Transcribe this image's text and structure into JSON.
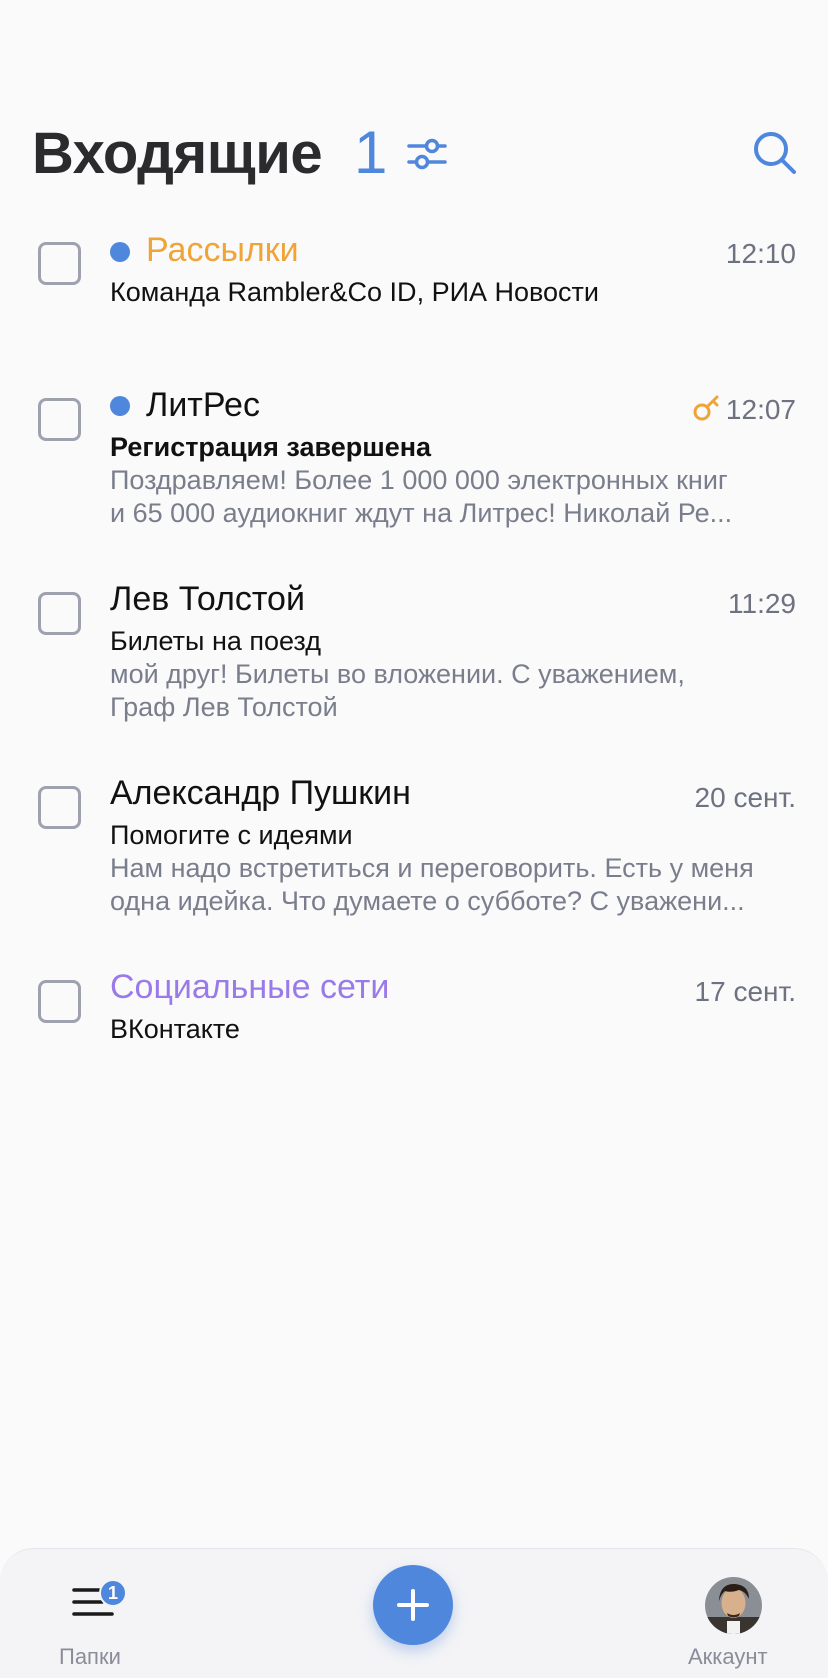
{
  "header": {
    "title": "Входящие",
    "unread_count": "1",
    "filter_icon": "sliders-icon",
    "search_icon": "search-icon"
  },
  "mails": [
    {
      "sender": "Рассылки",
      "sender_color": "#f0a437",
      "unread": true,
      "time": "12:10",
      "subject_bold": "Команда Rambler&Co ID",
      "subject_rest": ", РИА Новости",
      "preview_1": "",
      "preview_2": ""
    },
    {
      "sender": "ЛитРес",
      "sender_color": "#111111",
      "unread": true,
      "time": "12:07",
      "icon": "key-icon",
      "subject": "Регистрация завершена",
      "preview_1": "Поздравляем! Более 1 000 000 электронных книг",
      "preview_2": "и 65 000 аудиокниг ждут на Литрес! Николай Ре..."
    },
    {
      "sender": "Лев Толстой",
      "time": "11:29",
      "subject": "Билеты на поезд",
      "preview_1": "мой друг! Билеты во вложении. С уважением,",
      "preview_2": "Граф Лев Толстой"
    },
    {
      "sender": "Александр Пушкин",
      "time": "20 сент.",
      "subject": "Помогите с идеями",
      "preview_1": "Нам надо встретиться и переговорить. Есть у меня",
      "preview_2": "одна идейка. Что думаете о субботе? С уважени..."
    },
    {
      "sender": "Социальные сети",
      "sender_color": "#9a7ae8",
      "time": "17 сент.",
      "subject": "ВКонтакте"
    }
  ],
  "tabbar": {
    "folders_label": "Папки",
    "folders_badge": "1",
    "compose_icon": "plus-icon",
    "account_label": "Аккаунт"
  },
  "colors": {
    "accent": "#4f87dd",
    "newsletters": "#f0a437",
    "social": "#9a7ae8",
    "key": "#f0a437"
  }
}
